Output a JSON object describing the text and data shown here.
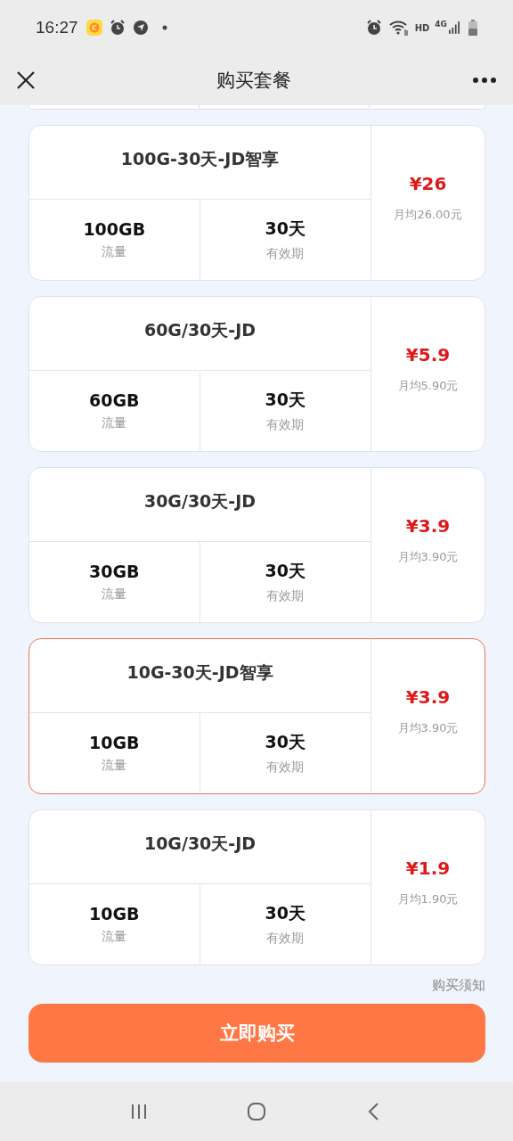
{
  "status_bar": {
    "time": "16:27",
    "network_labels": [
      "HD",
      "4G"
    ]
  },
  "nav_bar": {
    "title": "购买套餐"
  },
  "plans": [
    {
      "name": "100G-30天-JD智享",
      "data": "100GB",
      "data_label": "流量",
      "days": "30天",
      "days_label": "有效期",
      "price": "¥26",
      "monthly": "月均26.00元",
      "selected": false
    },
    {
      "name": "60G/30天-JD",
      "data": "60GB",
      "data_label": "流量",
      "days": "30天",
      "days_label": "有效期",
      "price": "¥5.9",
      "monthly": "月均5.90元",
      "selected": false
    },
    {
      "name": "30G/30天-JD",
      "data": "30GB",
      "data_label": "流量",
      "days": "30天",
      "days_label": "有效期",
      "price": "¥3.9",
      "monthly": "月均3.90元",
      "selected": false
    },
    {
      "name": "10G-30天-JD智享",
      "data": "10GB",
      "data_label": "流量",
      "days": "30天",
      "days_label": "有效期",
      "price": "¥3.9",
      "monthly": "月均3.90元",
      "selected": true
    },
    {
      "name": "10G/30天-JD",
      "data": "10GB",
      "data_label": "流量",
      "days": "30天",
      "days_label": "有效期",
      "price": "¥1.9",
      "monthly": "月均1.90元",
      "selected": false
    }
  ],
  "notice_link": "购买须知",
  "buy_button": "立即购买"
}
